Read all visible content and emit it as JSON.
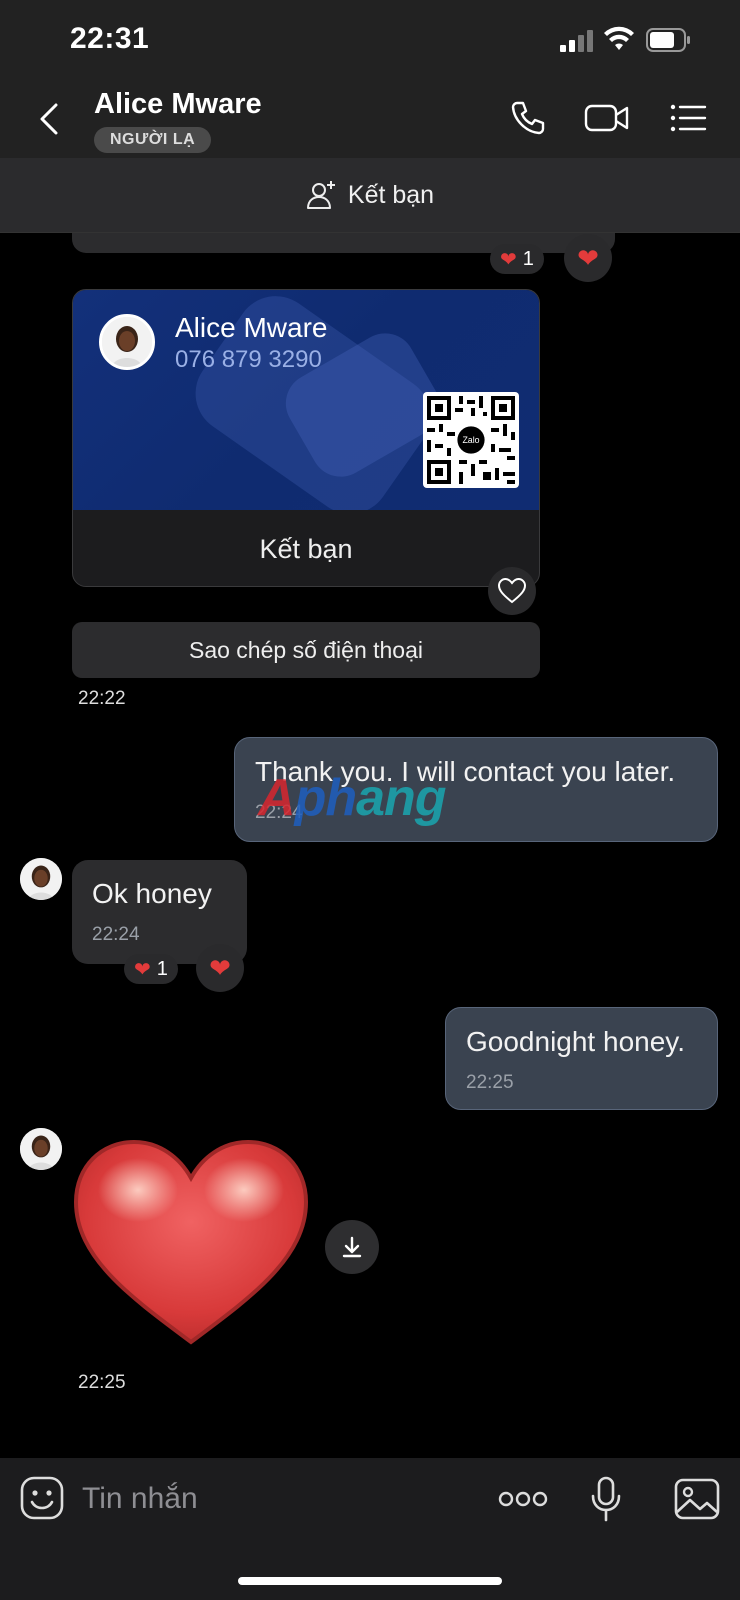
{
  "status_bar": {
    "time": "22:31"
  },
  "header": {
    "contact_name": "Alice Mware",
    "badge": "NGƯỜI LẠ"
  },
  "add_friend_bar": {
    "label": "Kết bạn"
  },
  "prev_message_reactions": {
    "heart_count": "1"
  },
  "contact_card": {
    "name": "Alice Mware",
    "phone": "076 879 3290",
    "qr_label": "Zalo",
    "button_label": "Kết bạn"
  },
  "copy_phone_button": {
    "label": "Sao chép số điện thoại"
  },
  "messages": [
    {
      "direction": "in",
      "time": "22:22"
    },
    {
      "direction": "out",
      "text": "Thank you. I will contact you later.",
      "time": "22:24"
    },
    {
      "direction": "in",
      "text": "Ok honey",
      "time": "22:24",
      "reaction_count": "1"
    },
    {
      "direction": "out",
      "text": "Goodnight honey.",
      "time": "22:25"
    },
    {
      "direction": "in",
      "sticker": "heart",
      "time": "22:25"
    }
  ],
  "watermark": {
    "part1": "A",
    "part2": "ph",
    "part3": "ang"
  },
  "composer": {
    "placeholder": "Tin nhắn"
  },
  "colors": {
    "background": "#000000",
    "bar": "#222222",
    "bubble_in": "#2c2c2e",
    "bubble_out": "#3a4350",
    "card_blue": "#13307a",
    "heart_red": "#e23b3b"
  },
  "icons": [
    "back-icon",
    "phone-icon",
    "video-icon",
    "menu-icon",
    "add-friend-icon",
    "heart-icon",
    "download-icon",
    "sticker-icon",
    "more-icon",
    "mic-icon",
    "image-icon"
  ]
}
